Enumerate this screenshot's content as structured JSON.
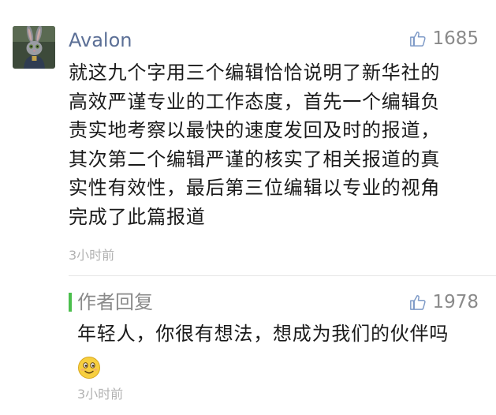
{
  "comment": {
    "username": "Avalon",
    "avatar_icon": "rabbit-avatar-icon",
    "like_count": "1685",
    "text_lines": [
      "就这九个字用三个编辑恰恰说明了新华社的",
      "高效严谨专业的工作态度，首先一个编辑负",
      "责实地考察以最快的速度发回及时的报道，",
      "其次第二个编辑严谨的核实了相关报道的真",
      "实性有效性，最后第三位编辑以专业的视角",
      "完成了此篇报道"
    ],
    "time": "3小时前"
  },
  "reply": {
    "label": "作者回复",
    "like_count": "1978",
    "text": "年轻人，你很有想法，想成为我们的伙伴吗",
    "emoji": "smiling-face-emoji",
    "time": "3小时前"
  },
  "colors": {
    "username": "#5b6f96",
    "accent_bar": "#4bbf4d",
    "muted": "#8a8a8a",
    "time": "#b2b2b2"
  }
}
